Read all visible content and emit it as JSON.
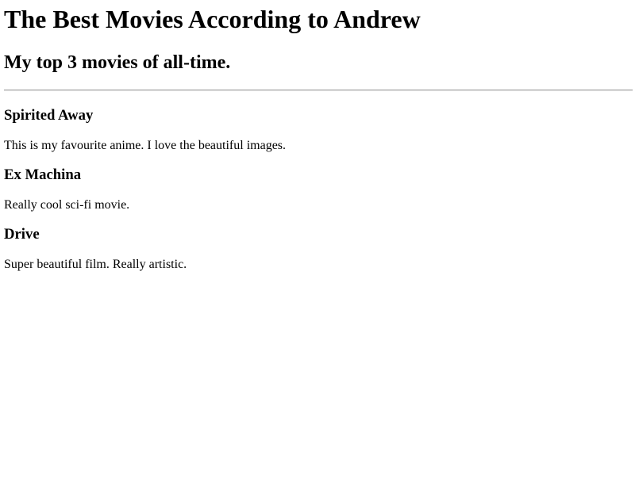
{
  "header": {
    "title": "The Best Movies According to Andrew",
    "subtitle": "My top 3 movies of all-time."
  },
  "movies": [
    {
      "title": "Spirited Away",
      "description": "This is my favourite anime. I love the beautiful images."
    },
    {
      "title": "Ex Machina",
      "description": "Really cool sci-fi movie."
    },
    {
      "title": "Drive",
      "description": "Super beautiful film. Really artistic."
    }
  ]
}
